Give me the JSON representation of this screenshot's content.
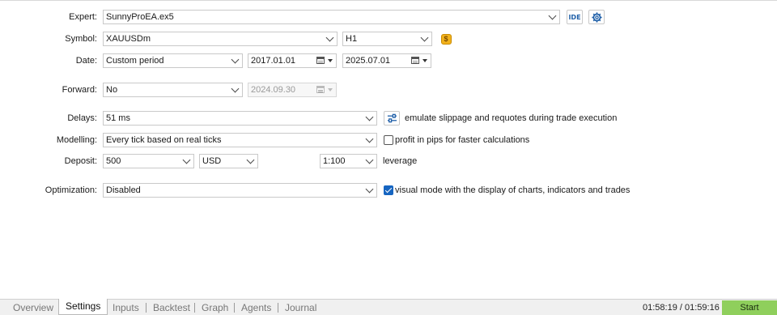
{
  "form": {
    "expert": {
      "label": "Expert:",
      "value": "SunnyProEA.ex5",
      "ide_label": "IDE"
    },
    "symbol": {
      "label": "Symbol:",
      "value": "XAUUSDm",
      "timeframe": "H1",
      "coin_glyph": "$"
    },
    "date": {
      "label": "Date:",
      "mode": "Custom period",
      "from": "2017.01.01",
      "to": "2025.07.01"
    },
    "forward": {
      "label": "Forward:",
      "value": "No",
      "date": "2024.09.30"
    },
    "delays": {
      "label": "Delays:",
      "value": "51 ms",
      "note": "emulate slippage and requotes during trade execution"
    },
    "modelling": {
      "label": "Modelling:",
      "value": "Every tick based on real ticks",
      "note": "profit in pips for faster calculations",
      "checked": false
    },
    "deposit": {
      "label": "Deposit:",
      "amount": "500",
      "currency": "USD",
      "leverage": "1:100",
      "leverage_label": "leverage"
    },
    "optimization": {
      "label": "Optimization:",
      "value": "Disabled",
      "note": "visual mode with the display of charts, indicators and trades",
      "checked": true
    }
  },
  "tabs": [
    "Overview",
    "Settings",
    "Inputs",
    "Backtest",
    "Graph",
    "Agents",
    "Journal"
  ],
  "active_tab": "Settings",
  "status": {
    "timer": "01:58:19 / 01:59:16",
    "start_label": "Start"
  },
  "colors": {
    "accent": "#1665c1",
    "start_button": "#8fcf5c",
    "coin": "#f2b21c"
  }
}
